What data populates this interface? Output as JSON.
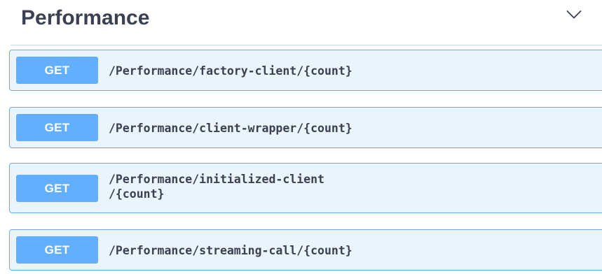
{
  "section": {
    "title": "Performance",
    "toggle_icon": "chevron-down-icon"
  },
  "colors": {
    "get_accent": "#61affe",
    "get_background": "#ebf3fb",
    "text": "#3b4151"
  },
  "operations": [
    {
      "method": "GET",
      "path_line1": "/Performance/factory-client/{count}",
      "path_line2": ""
    },
    {
      "method": "GET",
      "path_line1": "/Performance/client-wrapper/{count}",
      "path_line2": ""
    },
    {
      "method": "GET",
      "path_line1": "/Performance/initialized-client",
      "path_line2": "/{count}"
    },
    {
      "method": "GET",
      "path_line1": "/Performance/streaming-call/{count}",
      "path_line2": ""
    }
  ]
}
